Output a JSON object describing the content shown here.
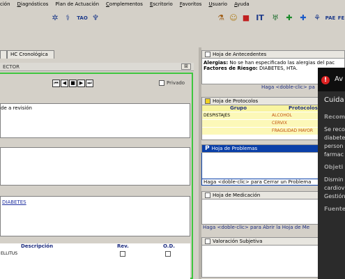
{
  "menu": [
    {
      "u": "",
      "rest": "ción"
    },
    {
      "u": "D",
      "rest": "iagnósticos"
    },
    {
      "u": "",
      "rest": "Plan de Actuación"
    },
    {
      "u": "C",
      "rest": "omplementos"
    },
    {
      "u": "E",
      "rest": "scritorio"
    },
    {
      "u": "F",
      "rest": "avoritos"
    },
    {
      "u": "U",
      "rest": "suario"
    },
    {
      "u": "A",
      "rest": "yuda"
    }
  ],
  "toolbar": {
    "icons": [
      "network-icon",
      "syringe-icon",
      "tao-icon",
      "trophy-icon",
      "lab-icon",
      "patient-icon",
      "stop-icon",
      "it-icon",
      "caduceus-icon",
      "green-cross-icon",
      "blue-cross-icon",
      "needle-icon",
      "pae-icon",
      "fe-icon"
    ],
    "tao_label": "TAO",
    "it_label": "IT",
    "pae_label": "PAE",
    "fe_label": "FE"
  },
  "tabs": {
    "first": "",
    "second": "HC Cronológica"
  },
  "left": {
    "title": "ECTOR",
    "close_label": "⊠",
    "privado_label": "Privado",
    "text1": "de a revisión",
    "diabetes": "DIABETES",
    "grid": {
      "headers": [
        "Descripción",
        "Rev.",
        "O.D."
      ],
      "row": "ELLITUS"
    }
  },
  "right": {
    "antecedentes": {
      "title": "Hoja de Antecedentes",
      "alergias_label": "Alergias:",
      "alergias_text": "No se han especificado las alergias del pac",
      "factores_label": "Factores de Riesgo:",
      "factores_text": "DIABETES, HTA.",
      "footer": "Haga <doble-clic> pa"
    },
    "protocolos": {
      "title": "Hoja de Protocolos",
      "headers": [
        "Grupo",
        "Protocolos"
      ],
      "rows": [
        {
          "grupo": "DESPISTAJES",
          "protocolo": "ALCOHOL"
        },
        {
          "grupo": "",
          "protocolo": "CERVIX"
        },
        {
          "grupo": "",
          "protocolo": "FRAGILIDAD MAYOR"
        }
      ]
    },
    "problemas": {
      "title": "Hoja de Problemas",
      "footer": "Haga <doble-clic> para Cerrar un Problema"
    },
    "medicacion": {
      "title": "Hoja de Medicación",
      "footer": "Haga <doble-clic> para Abrir la Hoja de Me"
    },
    "valoracion": {
      "title": "Valoración Subjetiva"
    }
  },
  "overlay": {
    "header": "Av",
    "line1": "Cuida",
    "line2": "Recom",
    "line3": "Se reco",
    "line4": "diabete",
    "line5": "person",
    "line6": "farmac",
    "line7": "Objeti",
    "line8": "Dismin",
    "line9": "cardiov",
    "line10": "Gestión",
    "line11": "Fuente"
  }
}
